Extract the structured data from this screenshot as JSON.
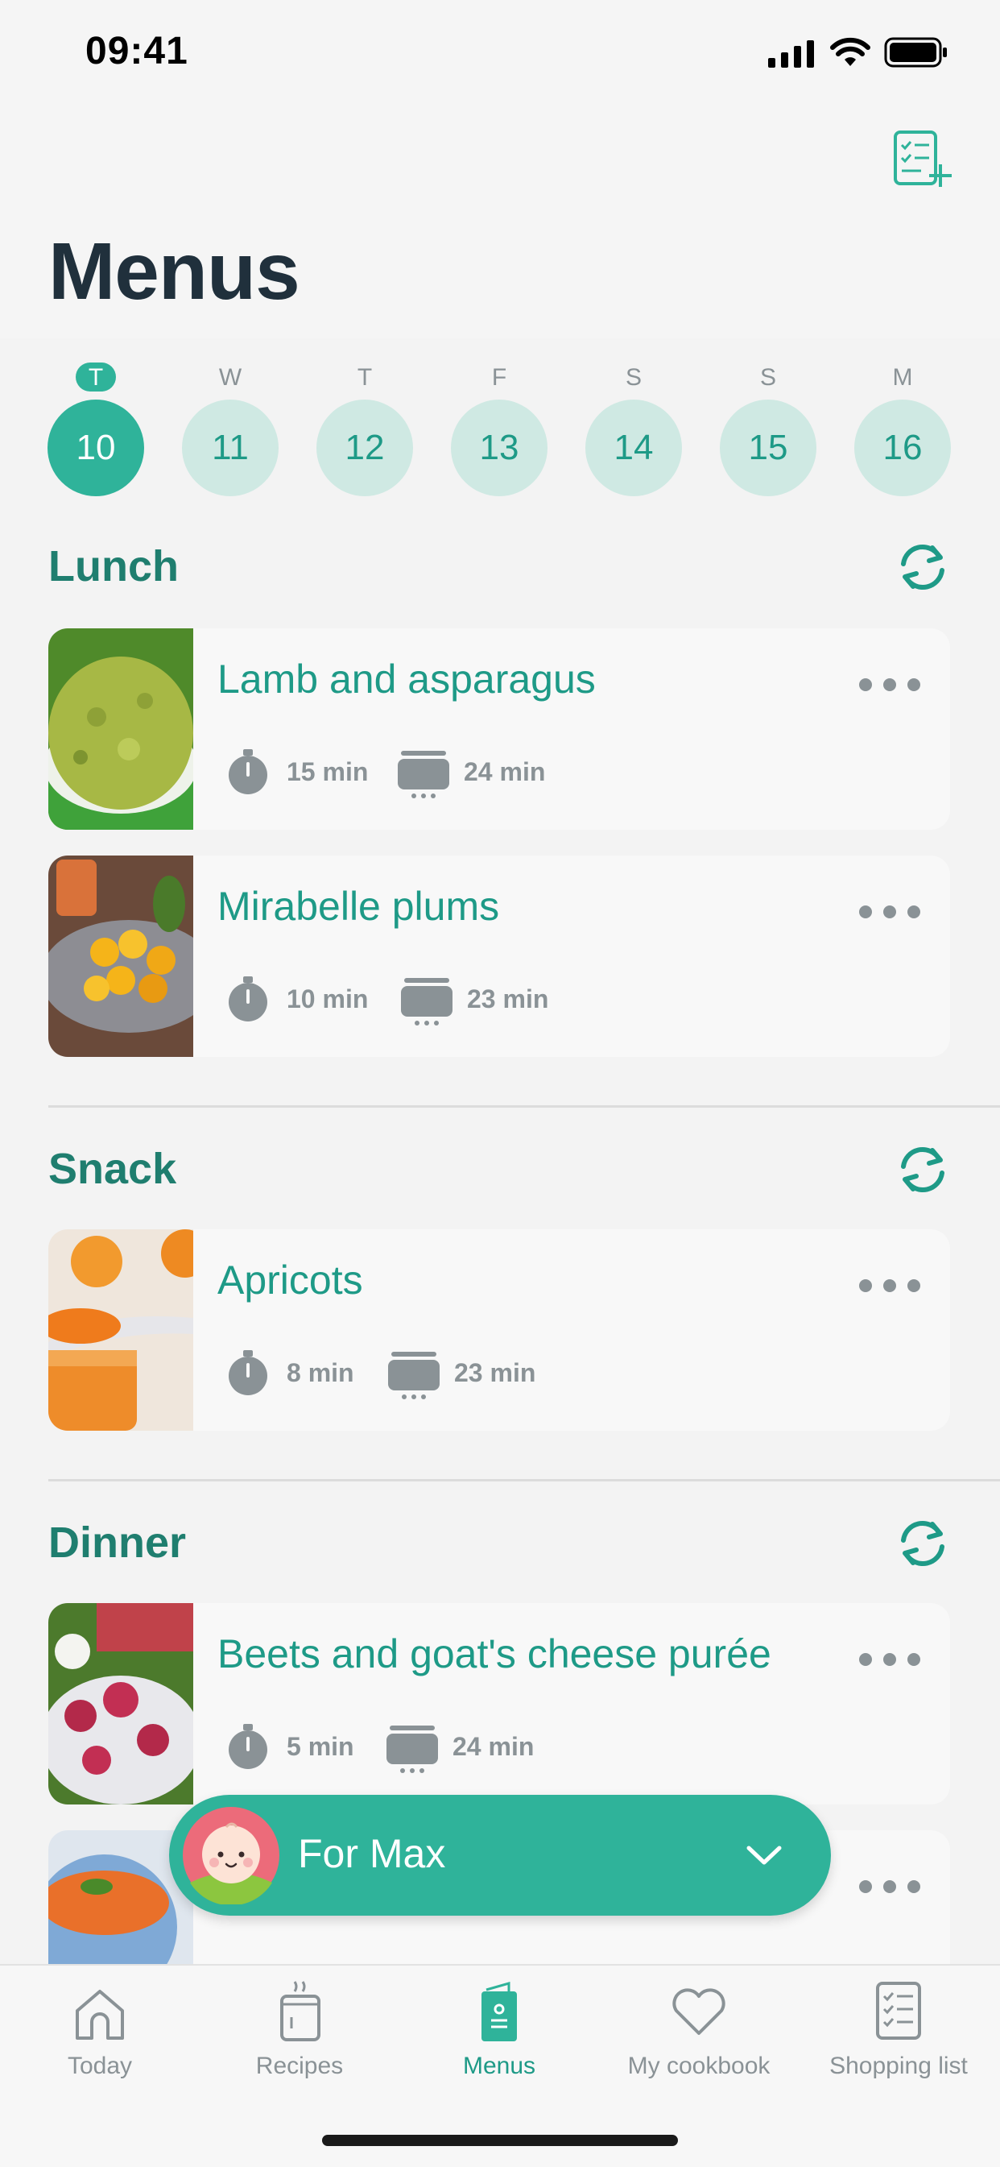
{
  "status": {
    "time": "09:41"
  },
  "page": {
    "title": "Menus"
  },
  "week": [
    {
      "letter": "T",
      "day": "10",
      "active": true
    },
    {
      "letter": "W",
      "day": "11"
    },
    {
      "letter": "T",
      "day": "12"
    },
    {
      "letter": "F",
      "day": "13"
    },
    {
      "letter": "S",
      "day": "14"
    },
    {
      "letter": "S",
      "day": "15"
    },
    {
      "letter": "M",
      "day": "16"
    }
  ],
  "sections": {
    "lunch": {
      "title": "Lunch",
      "recipes": [
        {
          "name": "Lamb and asparagus",
          "prep": "15 min",
          "cook": "24 min"
        },
        {
          "name": "Mirabelle plums",
          "prep": "10 min",
          "cook": "23 min"
        }
      ]
    },
    "snack": {
      "title": "Snack",
      "recipes": [
        {
          "name": "Apricots",
          "prep": "8 min",
          "cook": "23 min"
        }
      ]
    },
    "dinner": {
      "title": "Dinner",
      "recipes": [
        {
          "name": "Beets and goat's cheese purée",
          "prep": "5 min",
          "cook": "24 min"
        }
      ]
    }
  },
  "profile": {
    "label": "For Max"
  },
  "tabs": [
    {
      "label": "Today",
      "icon": "house-icon"
    },
    {
      "label": "Recipes",
      "icon": "pot-icon"
    },
    {
      "label": "Menus",
      "icon": "menu-book-icon",
      "active": true
    },
    {
      "label": "My cookbook",
      "icon": "heart-icon"
    },
    {
      "label": "Shopping list",
      "icon": "checklist-icon"
    }
  ],
  "colors": {
    "accent": "#2fb39a",
    "accent_dark": "#1e9a87",
    "section": "#1f7e6f",
    "muted": "#8a9296"
  }
}
